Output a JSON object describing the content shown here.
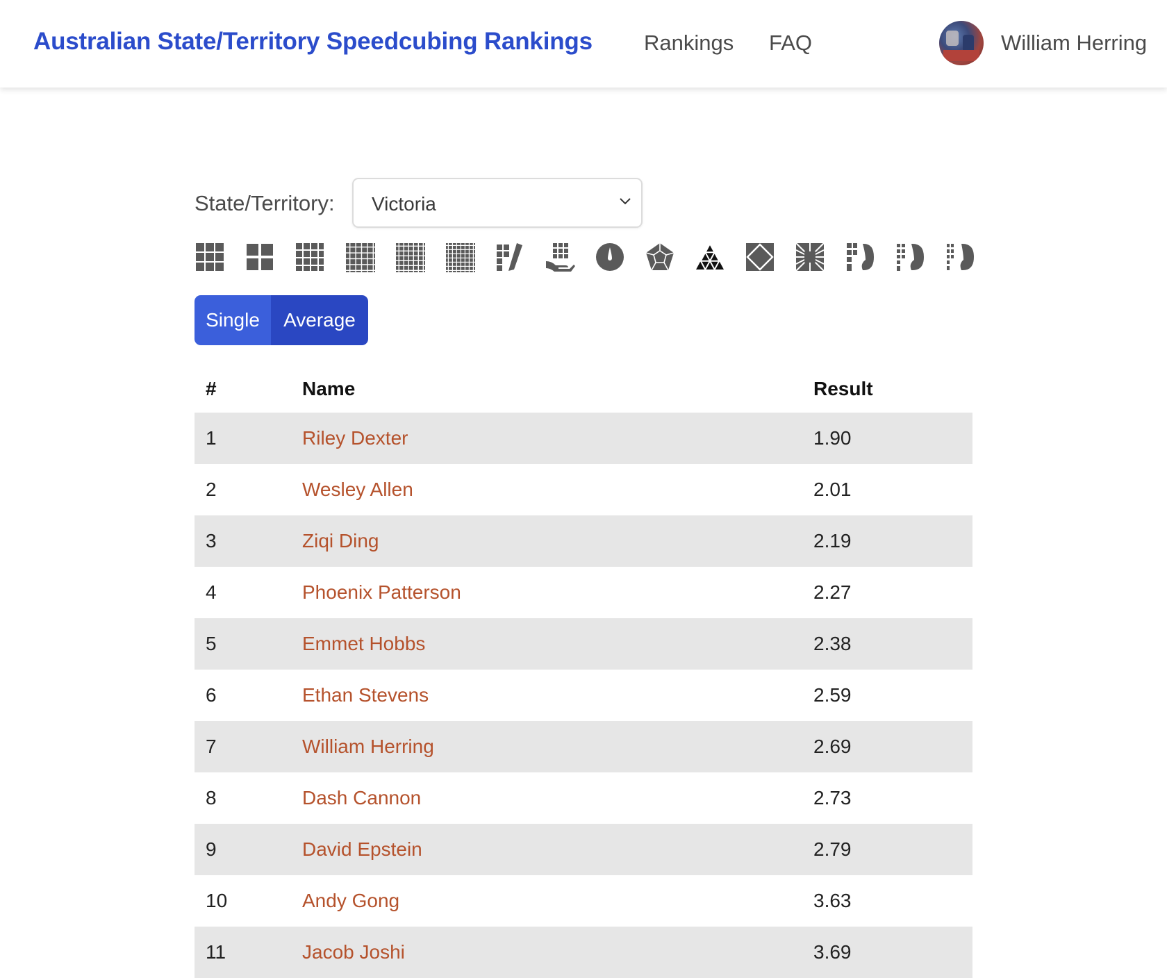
{
  "navbar": {
    "brand": "Australian State/Territory Speedcubing Rankings",
    "links": [
      "Rankings",
      "FAQ"
    ],
    "user_name": "William Herring"
  },
  "filters": {
    "state_label": "State/Territory:",
    "state_value": "Victoria",
    "events": [
      "3x3x3-cube-icon",
      "2x2x2-cube-icon",
      "4x4x4-cube-icon",
      "5x5x5-cube-icon",
      "6x6x6-cube-icon",
      "7x7x7-cube-icon",
      "3x3-blindfolded-icon",
      "3x3-one-handed-icon",
      "clock-icon",
      "megaminx-icon",
      "pyraminx-icon",
      "skewb-icon",
      "square-1-icon",
      "4x4-blindfolded-icon",
      "5x5-blindfolded-icon",
      "3x3-multi-blind-icon"
    ],
    "type_buttons": [
      "Single",
      "Average"
    ]
  },
  "table": {
    "headers": [
      "#",
      "Name",
      "Result"
    ],
    "rows": [
      {
        "rank": "1",
        "name": "Riley Dexter",
        "result": "1.90"
      },
      {
        "rank": "2",
        "name": "Wesley Allen",
        "result": "2.01"
      },
      {
        "rank": "3",
        "name": "Ziqi Ding",
        "result": "2.19"
      },
      {
        "rank": "4",
        "name": "Phoenix Patterson",
        "result": "2.27"
      },
      {
        "rank": "5",
        "name": "Emmet Hobbs",
        "result": "2.38"
      },
      {
        "rank": "6",
        "name": "Ethan Stevens",
        "result": "2.59"
      },
      {
        "rank": "7",
        "name": "William Herring",
        "result": "2.69"
      },
      {
        "rank": "8",
        "name": "Dash Cannon",
        "result": "2.73"
      },
      {
        "rank": "9",
        "name": "David Epstein",
        "result": "2.79"
      },
      {
        "rank": "10",
        "name": "Andy Gong",
        "result": "3.63"
      },
      {
        "rank": "11",
        "name": "Jacob Joshi",
        "result": "3.69"
      }
    ]
  },
  "colors": {
    "brand": "#2b4ccb",
    "link": "#b5522c",
    "button_single": "#3b5fdb",
    "button_average": "#2a47c2",
    "row_shade": "#e6e6e6"
  }
}
